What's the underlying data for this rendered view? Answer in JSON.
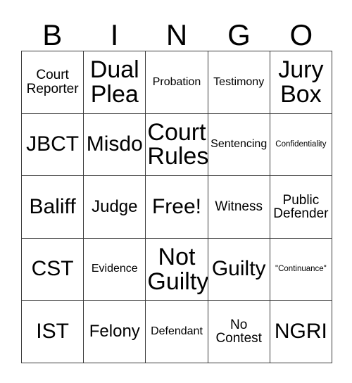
{
  "card": {
    "title": "BINGO",
    "header_letters": [
      "B",
      "I",
      "N",
      "G",
      "O"
    ],
    "free_space_label": "Free!",
    "rows": [
      [
        {
          "text": "Court\nReporter",
          "size": "sm"
        },
        {
          "text": "Dual\nPlea",
          "size": "xl"
        },
        {
          "text": "Probation",
          "size": "xs"
        },
        {
          "text": "Testimony",
          "size": "xs"
        },
        {
          "text": "Jury\nBox",
          "size": "xl"
        }
      ],
      [
        {
          "text": "JBCT",
          "size": "lg"
        },
        {
          "text": "Misdo",
          "size": "lg"
        },
        {
          "text": "Court\nRules",
          "size": "xl"
        },
        {
          "text": "Sentencing",
          "size": "xs"
        },
        {
          "text": "Confidentiality",
          "size": "xxs"
        }
      ],
      [
        {
          "text": "Baliff",
          "size": "lg"
        },
        {
          "text": "Judge",
          "size": "md"
        },
        {
          "text": "Free!",
          "size": "lg"
        },
        {
          "text": "Witness",
          "size": "sm"
        },
        {
          "text": "Public\nDefender",
          "size": "sm"
        }
      ],
      [
        {
          "text": "CST",
          "size": "lg"
        },
        {
          "text": "Evidence",
          "size": "xs"
        },
        {
          "text": "Not\nGuilty",
          "size": "xl"
        },
        {
          "text": "Guilty",
          "size": "lg"
        },
        {
          "text": "\"Continuance\"",
          "size": "xxs"
        }
      ],
      [
        {
          "text": "IST",
          "size": "lg"
        },
        {
          "text": "Felony",
          "size": "md"
        },
        {
          "text": "Defendant",
          "size": "xs"
        },
        {
          "text": "No\nContest",
          "size": "sm"
        },
        {
          "text": "NGRI",
          "size": "lg"
        }
      ]
    ]
  },
  "colors": {
    "background": "#ffffff",
    "text": "#000000",
    "grid_border": "#3a3a3a"
  }
}
